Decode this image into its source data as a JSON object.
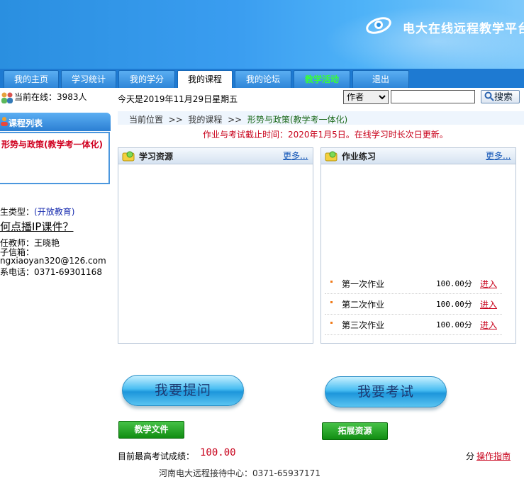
{
  "banner": {
    "logo_text": "电大在线远程教学平台"
  },
  "nav": {
    "tabs": [
      {
        "label": "我的主页"
      },
      {
        "label": "学习统计"
      },
      {
        "label": "我的学分"
      },
      {
        "label": "我的课程"
      },
      {
        "label": "我的论坛"
      },
      {
        "label": "教学活动"
      },
      {
        "label": "退出"
      }
    ],
    "active_tab": "我的课程"
  },
  "info": {
    "online_label": "当前在线：",
    "online_count": "3983人",
    "today": "今天是2019年11月29日星期五",
    "search_field": "作者",
    "search_button": "搜索"
  },
  "left": {
    "course_list_title": "课程列表",
    "course_item": "形势与政策(教学考一体化)",
    "student_type_label": "生类型：",
    "student_type_value": "(开放教育)",
    "ip_link": "何点播IP课件？",
    "teacher": "任教师：王晓艳",
    "email_label": "子信箱：",
    "email": "ngxiaoyan320@126.com",
    "phone": "系电话：0371-69301168"
  },
  "breadcrumb": {
    "position_label": "当前位置",
    "sep": ">>",
    "level1": "我的课程",
    "level2": "形势与政策(教学考一体化)"
  },
  "deadline": "作业与考试截止时间：2020年1月5日。在线学习时长次日更新。",
  "resources": {
    "title": "学习资源",
    "more": "更多..."
  },
  "homework": {
    "title": "作业练习",
    "more": "更多...",
    "items": [
      {
        "name": "第一次作业",
        "score": "100.00分",
        "action": "进入"
      },
      {
        "name": "第二次作业",
        "score": "100.00分",
        "action": "进入"
      },
      {
        "name": "第三次作业",
        "score": "100.00分",
        "action": "进入"
      }
    ]
  },
  "actions": {
    "ask": "我要提问",
    "exam": "我要考试",
    "teaching_files": "教学文件",
    "extended_resources": "拓展资源"
  },
  "score": {
    "label": "目前最高考试成绩：",
    "value": "100.00",
    "unit": "分",
    "guide": "操作指南"
  },
  "footer": "河南电大远程接待中心：0371-65937171"
}
